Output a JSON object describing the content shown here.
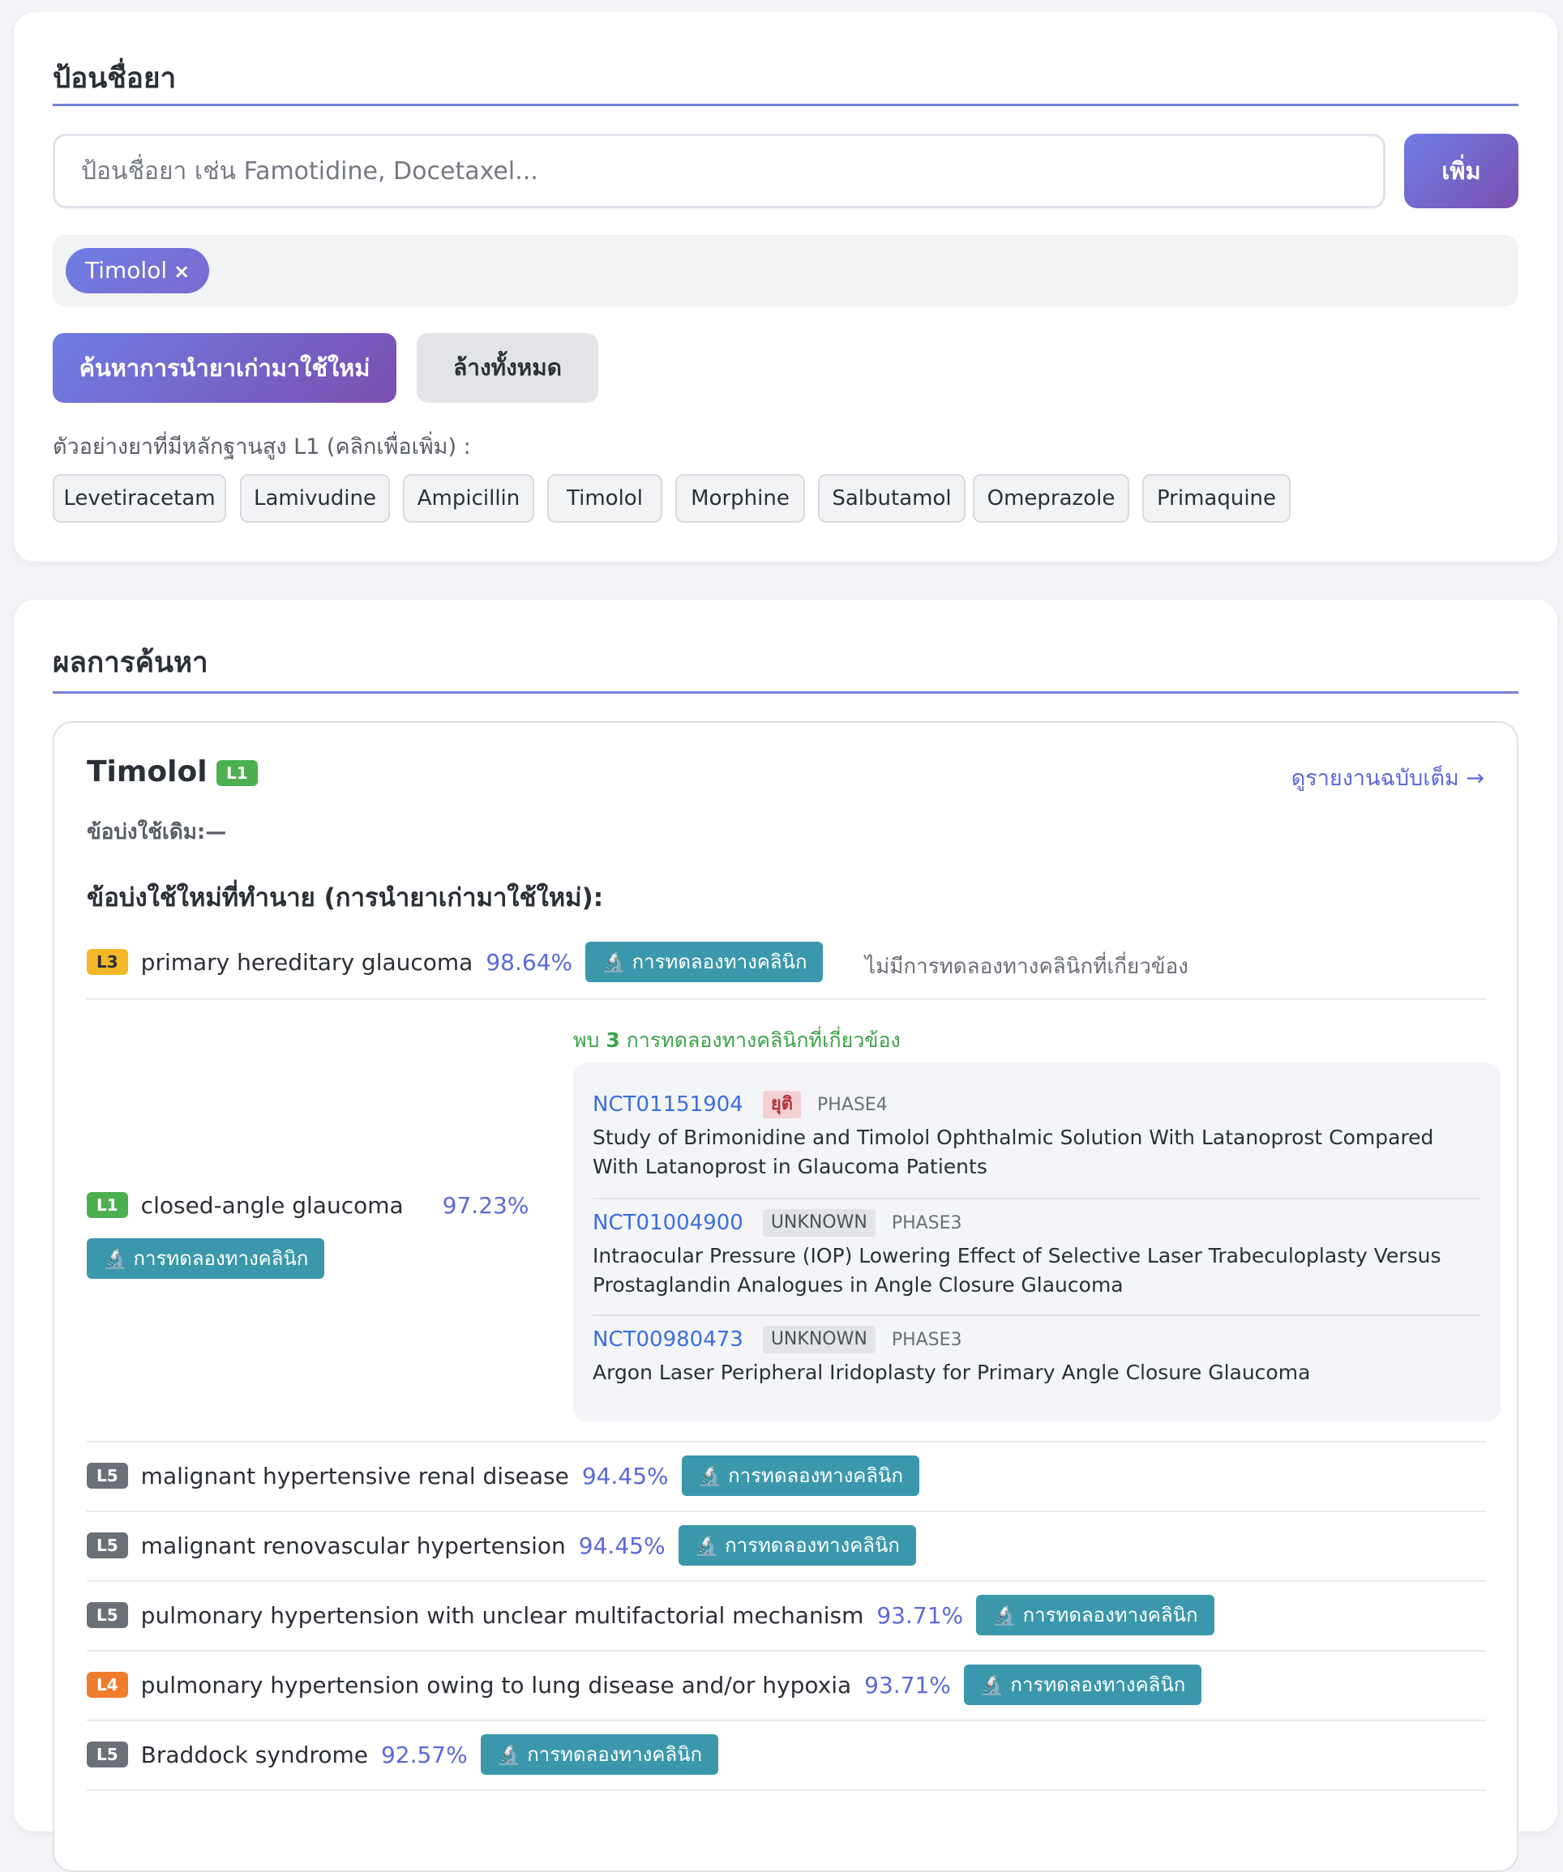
{
  "input_section": {
    "title": "ป้อนชื่อยา",
    "input_placeholder": "ป้อนชื่อยา เช่น Famotidine, Docetaxel...",
    "add_label": "เพิ่ม",
    "selected_tags": [
      {
        "label": "Timolol",
        "remove": "×"
      }
    ],
    "search_label": "ค้นหาการนำยาเก่ามาใช้ใหม่",
    "clear_label": "ล้างทั้งหมด",
    "examples_label": "ตัวอย่างยาที่มีหลักฐานสูง L1 (คลิกเพื่อเพิ่ม) :",
    "examples": [
      "Levetiracetam",
      "Lamivudine",
      "Ampicillin",
      "Timolol",
      "Morphine",
      "Salbutamol",
      "Omeprazole",
      "Primaquine"
    ]
  },
  "results_section": {
    "title": "ผลการค้นหา",
    "drug": {
      "name": "Timolol",
      "level": "L1",
      "full_report_label": "ดูรายงานฉบับเต็ม →",
      "original_indication": "ข้อบ่งใช้เดิม:—",
      "predicted_title": "ข้อบ่งใช้ใหม่ที่ทำนาย (การนำยาเก่ามาใช้ใหม่):",
      "trial_button_label": "🔬 การทดลองทางคลินิก",
      "no_trials_text": "ไม่มีการทดลองทางคลินิกที่เกี่ยวข้อง",
      "found_prefix": "พบ",
      "found_count": "3",
      "found_suffix": "การทดลองทางคลินิกที่เกี่ยวข้อง",
      "indications": [
        {
          "level": "L3",
          "name": "primary hereditary glaucoma",
          "score": "98.64%"
        },
        {
          "level": "L1",
          "name": "closed-angle glaucoma",
          "score": "97.23%"
        },
        {
          "level": "L5",
          "name": "malignant hypertensive renal disease",
          "score": "94.45%"
        },
        {
          "level": "L5",
          "name": "malignant renovascular hypertension",
          "score": "94.45%"
        },
        {
          "level": "L5",
          "name": "pulmonary hypertension with unclear multifactorial mechanism",
          "score": "93.71%"
        },
        {
          "level": "L4",
          "name": "pulmonary hypertension owing to lung disease and/or hypoxia",
          "score": "93.71%"
        },
        {
          "level": "L5",
          "name": "Braddock syndrome",
          "score": "92.57%"
        }
      ],
      "trials": [
        {
          "id": "NCT01151904",
          "status": "ยุติ",
          "phase": "PHASE4",
          "title": "Study of Brimonidine and Timolol Ophthalmic Solution With Latanoprost Compared With Latanoprost in Glaucoma Patients"
        },
        {
          "id": "NCT01004900",
          "status": "UNKNOWN",
          "phase": "PHASE3",
          "title": "Intraocular Pressure (IOP) Lowering Effect of Selective Laser Trabeculoplasty Versus Prostaglandin Analogues in Angle Closure Glaucoma"
        },
        {
          "id": "NCT00980473",
          "status": "UNKNOWN",
          "phase": "PHASE3",
          "title": "Argon Laser Peripheral Iridoplasty for Primary Angle Closure Glaucoma"
        }
      ]
    }
  },
  "colors": {
    "accent": "#7880dc",
    "gradient_start": "#6f7de3",
    "gradient_end": "#7a4fb0",
    "trial_button": "#3b98ac",
    "score": "#5b6ad8",
    "found_note": "#3ea34a"
  }
}
